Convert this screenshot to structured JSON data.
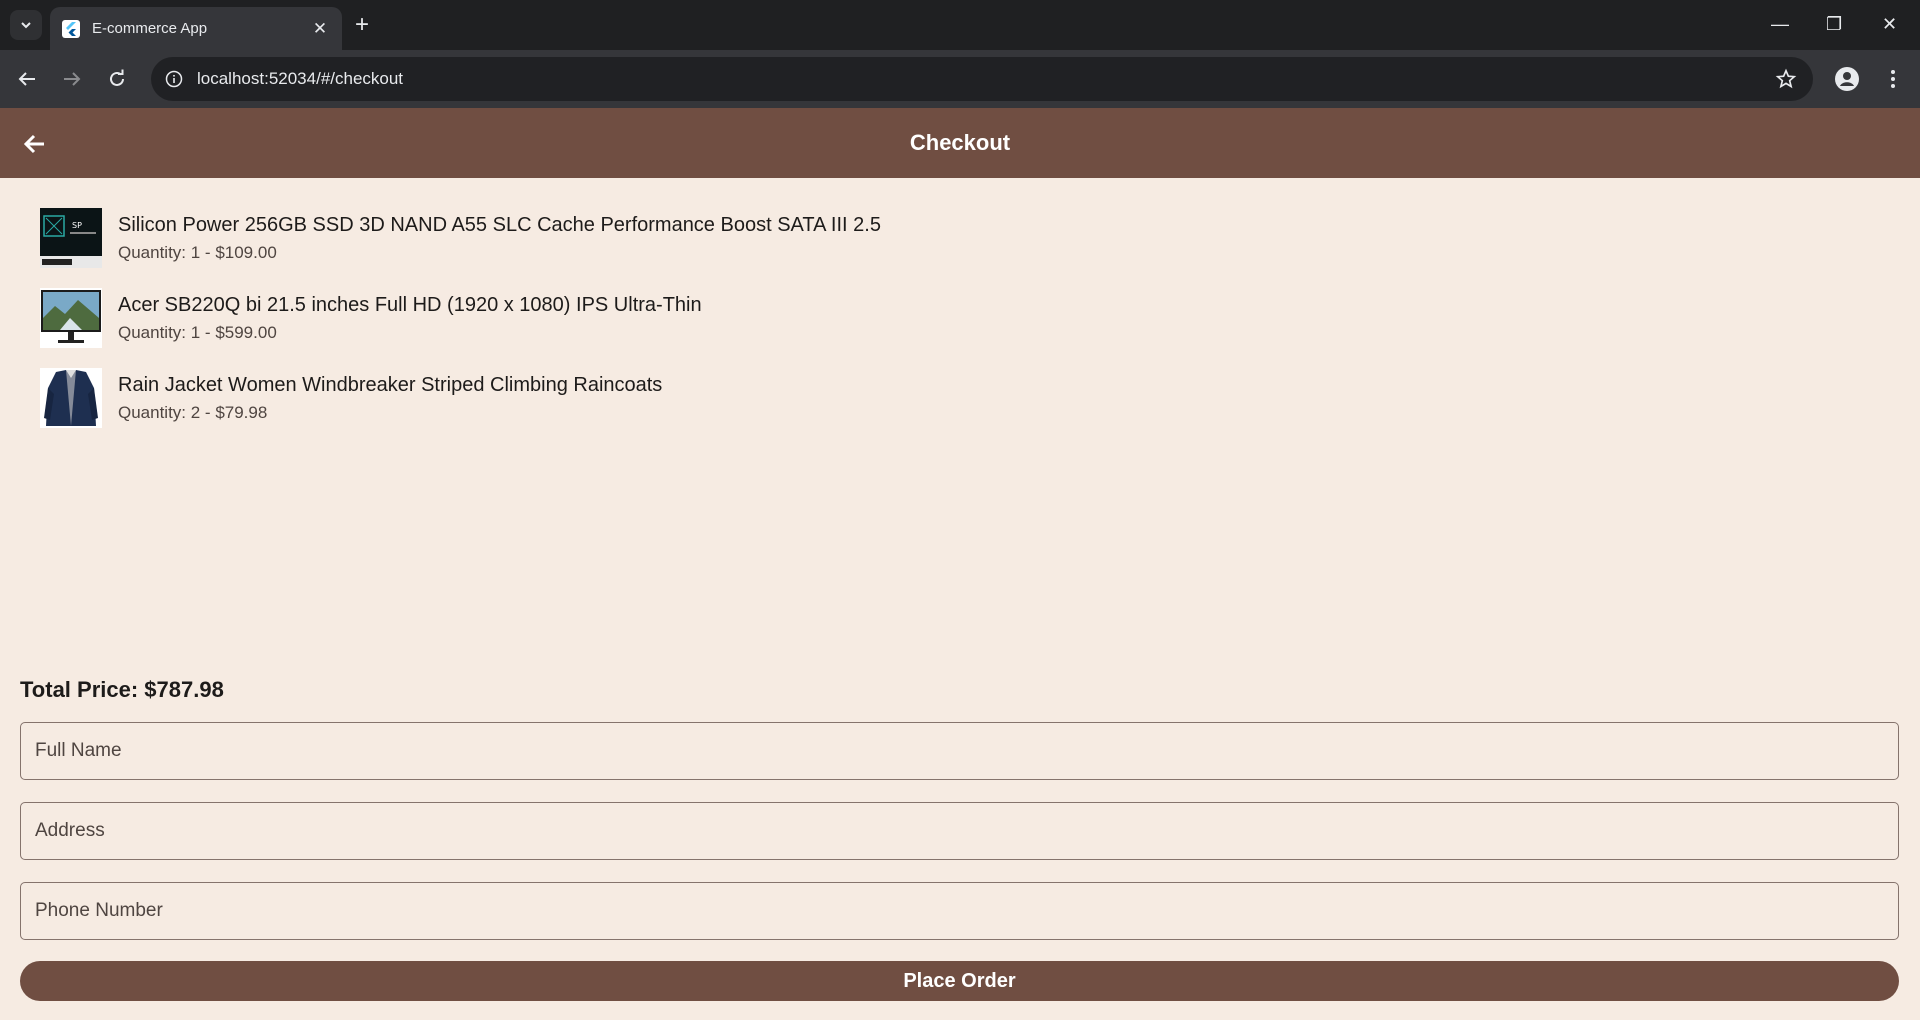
{
  "browser": {
    "tab_title": "E-commerce App",
    "url": "localhost:52034/#/checkout"
  },
  "appbar": {
    "title": "Checkout",
    "color": "#704e42"
  },
  "cart": {
    "items": [
      {
        "name": "Silicon Power 256GB SSD 3D NAND A55 SLC Cache Performance Boost SATA III 2.5",
        "details": "Quantity: 1 - $109.00"
      },
      {
        "name": "Acer SB220Q bi 21.5 inches Full HD (1920 x 1080) IPS Ultra-Thin",
        "details": "Quantity: 1 - $599.00"
      },
      {
        "name": "Rain Jacket Women Windbreaker Striped Climbing Raincoats",
        "details": "Quantity: 2 - $79.98"
      }
    ],
    "total": "Total Price: $787.98"
  },
  "form": {
    "full_name_placeholder": "Full Name",
    "address_placeholder": "Address",
    "phone_placeholder": "Phone Number",
    "submit_label": "Place Order"
  },
  "icons": {
    "tab_search": "chevron-down-icon",
    "back": "arrow-left-icon",
    "forward": "arrow-right-icon",
    "reload": "reload-icon",
    "site_info": "info-icon",
    "bookmark": "star-icon",
    "profile": "person-icon",
    "menu": "more-vert-icon"
  }
}
